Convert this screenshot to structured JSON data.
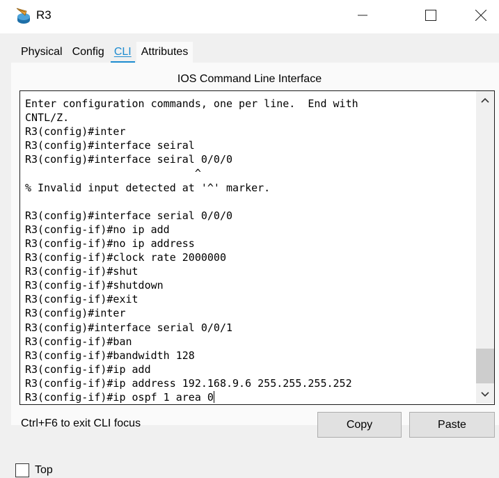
{
  "window": {
    "title": "R3",
    "minimize_glyph": "—",
    "maximize_glyph": "☐",
    "close_glyph": "✕"
  },
  "tabs": [
    {
      "label": "Physical",
      "active": false
    },
    {
      "label": "Config",
      "active": false
    },
    {
      "label": "CLI",
      "active": true
    },
    {
      "label": "Attributes",
      "active": false
    }
  ],
  "cli": {
    "section_title": "IOS Command Line Interface",
    "lines": [
      "Enter configuration commands, one per line.  End with",
      "CNTL/Z.",
      "R3(config)#inter",
      "R3(config)#interface seiral",
      "R3(config)#interface seiral 0/0/0",
      "                           ^",
      "% Invalid input detected at '^' marker.",
      "",
      "R3(config)#interface serial 0/0/0",
      "R3(config-if)#no ip add",
      "R3(config-if)#no ip address",
      "R3(config-if)#clock rate 2000000",
      "R3(config-if)#shut",
      "R3(config-if)#shutdown",
      "R3(config-if)#exit",
      "R3(config)#inter",
      "R3(config)#interface serial 0/0/1",
      "R3(config-if)#ban",
      "R3(config-if)#bandwidth 128",
      "R3(config-if)#ip add",
      "R3(config-if)#ip address 192.168.9.6 255.255.255.252",
      "R3(config-if)#ip ospf 1 area 0"
    ]
  },
  "footer": {
    "hint": "Ctrl+F6 to exit CLI focus",
    "copy_label": "Copy",
    "paste_label": "Paste",
    "top_label": "Top"
  },
  "icons": {
    "app": "router-icon",
    "scroll_up": "chevron-up-icon",
    "scroll_down": "chevron-down-icon"
  },
  "colors": {
    "active_tab": "#1c8bd0",
    "panel_bg": "#f0f0f0"
  }
}
